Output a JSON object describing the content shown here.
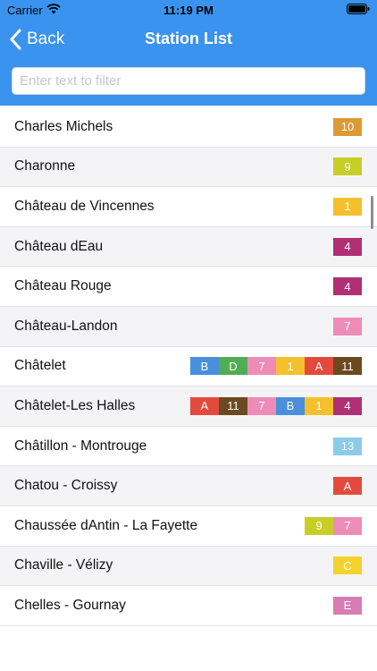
{
  "status": {
    "carrier": "Carrier",
    "time": "11:19 PM"
  },
  "nav": {
    "back_label": "Back",
    "title": "Station List",
    "background_color": "#3a93ee"
  },
  "search": {
    "placeholder": "Enter text to filter",
    "value": ""
  },
  "stations": [
    {
      "name": "Charles Michels",
      "lines": [
        {
          "label": "10",
          "color": "#dc9a34"
        }
      ]
    },
    {
      "name": "Charonne",
      "lines": [
        {
          "label": "9",
          "color": "#c7cf27"
        }
      ]
    },
    {
      "name": "Château de Vincennes",
      "lines": [
        {
          "label": "1",
          "color": "#f5c02e"
        }
      ]
    },
    {
      "name": "Château dEau",
      "lines": [
        {
          "label": "4",
          "color": "#b02f75"
        }
      ]
    },
    {
      "name": "Château Rouge",
      "lines": [
        {
          "label": "4",
          "color": "#b02f75"
        }
      ]
    },
    {
      "name": "Château-Landon",
      "lines": [
        {
          "label": "7",
          "color": "#ee8cb8"
        }
      ]
    },
    {
      "name": "Châtelet",
      "lines": [
        {
          "label": "B",
          "color": "#4a8fdd"
        },
        {
          "label": "D",
          "color": "#4fae55"
        },
        {
          "label": "7",
          "color": "#ee8cb8"
        },
        {
          "label": "1",
          "color": "#f5c02e"
        },
        {
          "label": "A",
          "color": "#e44a3c"
        },
        {
          "label": "11",
          "color": "#6c4a1f"
        }
      ]
    },
    {
      "name": "Châtelet-Les Halles",
      "lines": [
        {
          "label": "A",
          "color": "#e44a3c"
        },
        {
          "label": "11",
          "color": "#6c4a1f"
        },
        {
          "label": "7",
          "color": "#ee8cb8"
        },
        {
          "label": "B",
          "color": "#4a8fdd"
        },
        {
          "label": "1",
          "color": "#f5c02e"
        },
        {
          "label": "4",
          "color": "#b02f75"
        }
      ]
    },
    {
      "name": "Châtillon - Montrouge",
      "lines": [
        {
          "label": "13",
          "color": "#8ccbe8"
        }
      ]
    },
    {
      "name": "Chatou - Croissy",
      "lines": [
        {
          "label": "A",
          "color": "#e44a3c"
        }
      ]
    },
    {
      "name": "Chaussée dAntin - La Fayette",
      "lines": [
        {
          "label": "9",
          "color": "#c7cf27"
        },
        {
          "label": "7",
          "color": "#ee8cb8"
        }
      ]
    },
    {
      "name": "Chaville - Vélizy",
      "lines": [
        {
          "label": "C",
          "color": "#f3d22e"
        }
      ]
    },
    {
      "name": "Chelles - Gournay",
      "lines": [
        {
          "label": "E",
          "color": "#d77cb5"
        }
      ]
    }
  ]
}
